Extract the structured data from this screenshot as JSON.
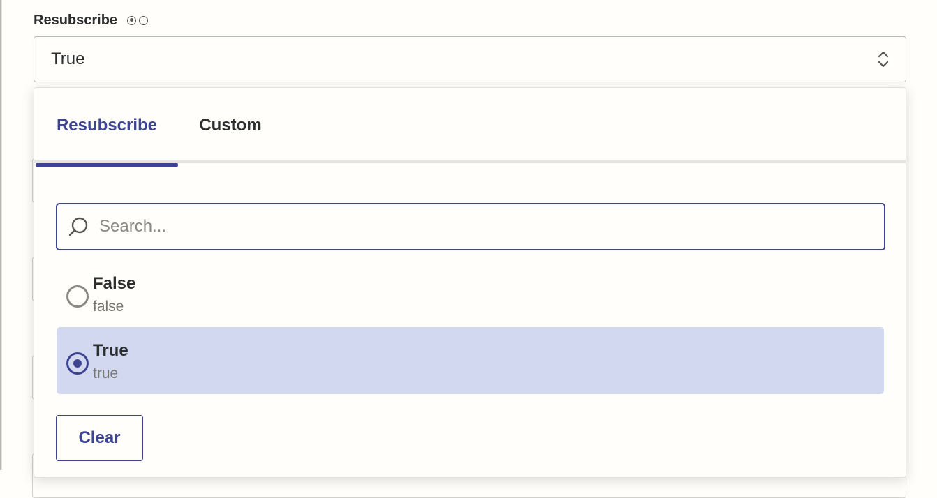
{
  "field": {
    "label": "Resubscribe",
    "selected_value": "True",
    "type_icons": [
      "radio-filled-icon",
      "radio-empty-icon"
    ]
  },
  "dropdown": {
    "tabs": [
      {
        "label": "Resubscribe",
        "active": true
      },
      {
        "label": "Custom",
        "active": false
      }
    ],
    "search": {
      "placeholder": "Search...",
      "value": ""
    },
    "options": [
      {
        "label": "False",
        "value": "false",
        "selected": false
      },
      {
        "label": "True",
        "value": "true",
        "selected": true
      }
    ],
    "clear_label": "Clear"
  },
  "colors": {
    "accent": "#3d4592",
    "selected_bg": "#d3d8f1",
    "background": "#fffefb",
    "text": "#2d2e2e",
    "muted_text": "#77766f"
  }
}
